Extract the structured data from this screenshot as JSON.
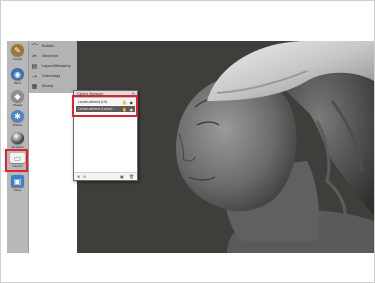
{
  "toolbar": {
    "items": [
      {
        "label": "Sculpt",
        "icon": "brush-icon",
        "color": "#a0752f"
      },
      {
        "label": "Paint",
        "icon": "paint-icon",
        "color": "#3d6fb5"
      },
      {
        "label": "Shape",
        "icon": "shape-icon",
        "color": "#8f8f8f"
      },
      {
        "label": "Stamp",
        "icon": "stamp-icon",
        "color": "#4d86c6"
      },
      {
        "label": "Shaders",
        "icon": "material-sphere-icon",
        "color": "#2a2a2a"
      },
      {
        "label": "Layers",
        "icon": "layers-icon",
        "color": "#f2f2f2"
      },
      {
        "label": "Save",
        "icon": "save-icon",
        "color": "#3f7fc4"
      }
    ]
  },
  "submenu": {
    "items": [
      {
        "label": "Subdiv",
        "icon": "subdivide-icon"
      },
      {
        "label": "Selection",
        "icon": "selection-icon"
      },
      {
        "label": "Layout/Retoping",
        "icon": "layout-icon"
      },
      {
        "label": "Overdrags",
        "icon": "overdrags-icon"
      },
      {
        "label": "Stamp",
        "icon": "stamp-small-icon"
      }
    ]
  },
  "layers_panel": {
    "title": "Object Browser",
    "rows": [
      {
        "label": "Laurel-athena (Lit)"
      },
      {
        "label": "Laurel-athena (Layer)"
      }
    ]
  },
  "colors": {
    "highlight": "#e0242f",
    "viewport_bg": "#3e3e3a",
    "toolbar_bg": "#b8b8b8"
  }
}
